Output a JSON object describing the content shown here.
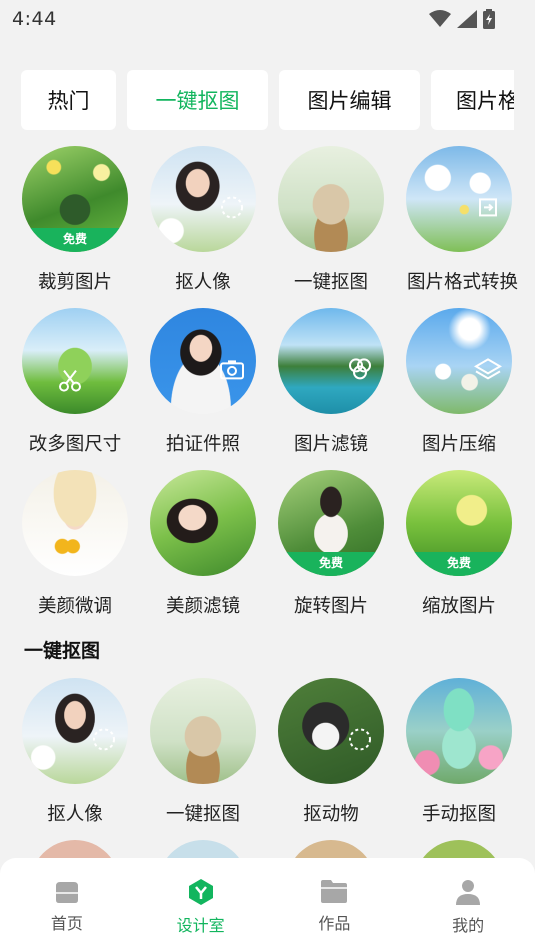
{
  "status": {
    "time": "4:44"
  },
  "tabs": [
    {
      "label": "热门",
      "active": false
    },
    {
      "label": "一键抠图",
      "active": true
    },
    {
      "label": "图片编辑",
      "active": false
    },
    {
      "label": "图片格",
      "active": false
    }
  ],
  "tools": [
    {
      "label": "裁剪图片",
      "badge": "免费"
    },
    {
      "label": "抠人像"
    },
    {
      "label": "一键抠图"
    },
    {
      "label": "图片格式转换"
    },
    {
      "label": "改多图尺寸"
    },
    {
      "label": "拍证件照"
    },
    {
      "label": "图片滤镜"
    },
    {
      "label": "图片压缩"
    },
    {
      "label": "美颜微调"
    },
    {
      "label": "美颜滤镜"
    },
    {
      "label": "旋转图片",
      "badge": "免费"
    },
    {
      "label": "缩放图片",
      "badge": "免费"
    }
  ],
  "section": {
    "title": "一键抠图"
  },
  "cutout_tools": [
    {
      "label": "抠人像"
    },
    {
      "label": "一键抠图"
    },
    {
      "label": "抠动物"
    },
    {
      "label": "手动抠图"
    }
  ],
  "nav": [
    {
      "label": "首页",
      "icon": "home-icon",
      "active": false
    },
    {
      "label": "设计室",
      "icon": "design-icon",
      "active": true
    },
    {
      "label": "作品",
      "icon": "folder-icon",
      "active": false
    },
    {
      "label": "我的",
      "icon": "person-icon",
      "active": false
    }
  ],
  "colors": {
    "accent": "#12b55e",
    "badge": "#19b35c",
    "background": "#f2f2f2"
  }
}
